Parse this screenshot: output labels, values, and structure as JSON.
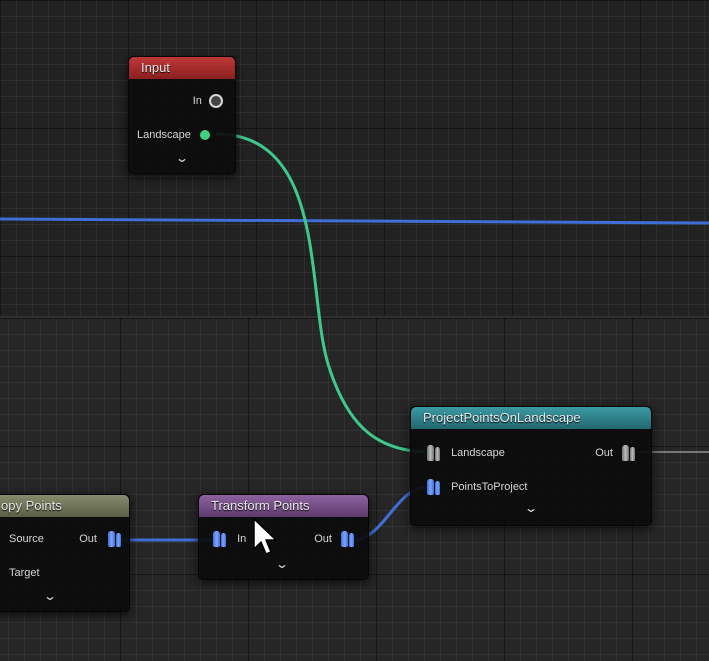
{
  "colors": {
    "input_header": "#a52a2a",
    "project_header": "#2e7c85",
    "transform_header": "#7a4f8a",
    "copy_header": "#6f7458",
    "landscape_wire": "#3ec98a",
    "points_wire": "#3f6fd6"
  },
  "nodes": {
    "input": {
      "title": "Input",
      "pins": {
        "in_label": "In",
        "landscape_label": "Landscape"
      }
    },
    "project": {
      "title": "ProjectPointsOnLandscape",
      "pins": {
        "landscape_label": "Landscape",
        "out_label": "Out",
        "points_label": "PointsToProject"
      }
    },
    "transform": {
      "title": "Transform Points",
      "pins": {
        "in_label": "In",
        "out_label": "Out"
      }
    },
    "copy": {
      "title": "opy Points",
      "pins": {
        "source_label": "Source",
        "out_label": "Out",
        "target_label": "Target"
      }
    }
  },
  "icons": {
    "expand": "chevron-down-icon",
    "cursor": "mouse-cursor-icon",
    "point_pin": "point-data-pin-icon",
    "landscape_pin": "landscape-pin-icon",
    "in_pin": "ring-pin-icon"
  }
}
